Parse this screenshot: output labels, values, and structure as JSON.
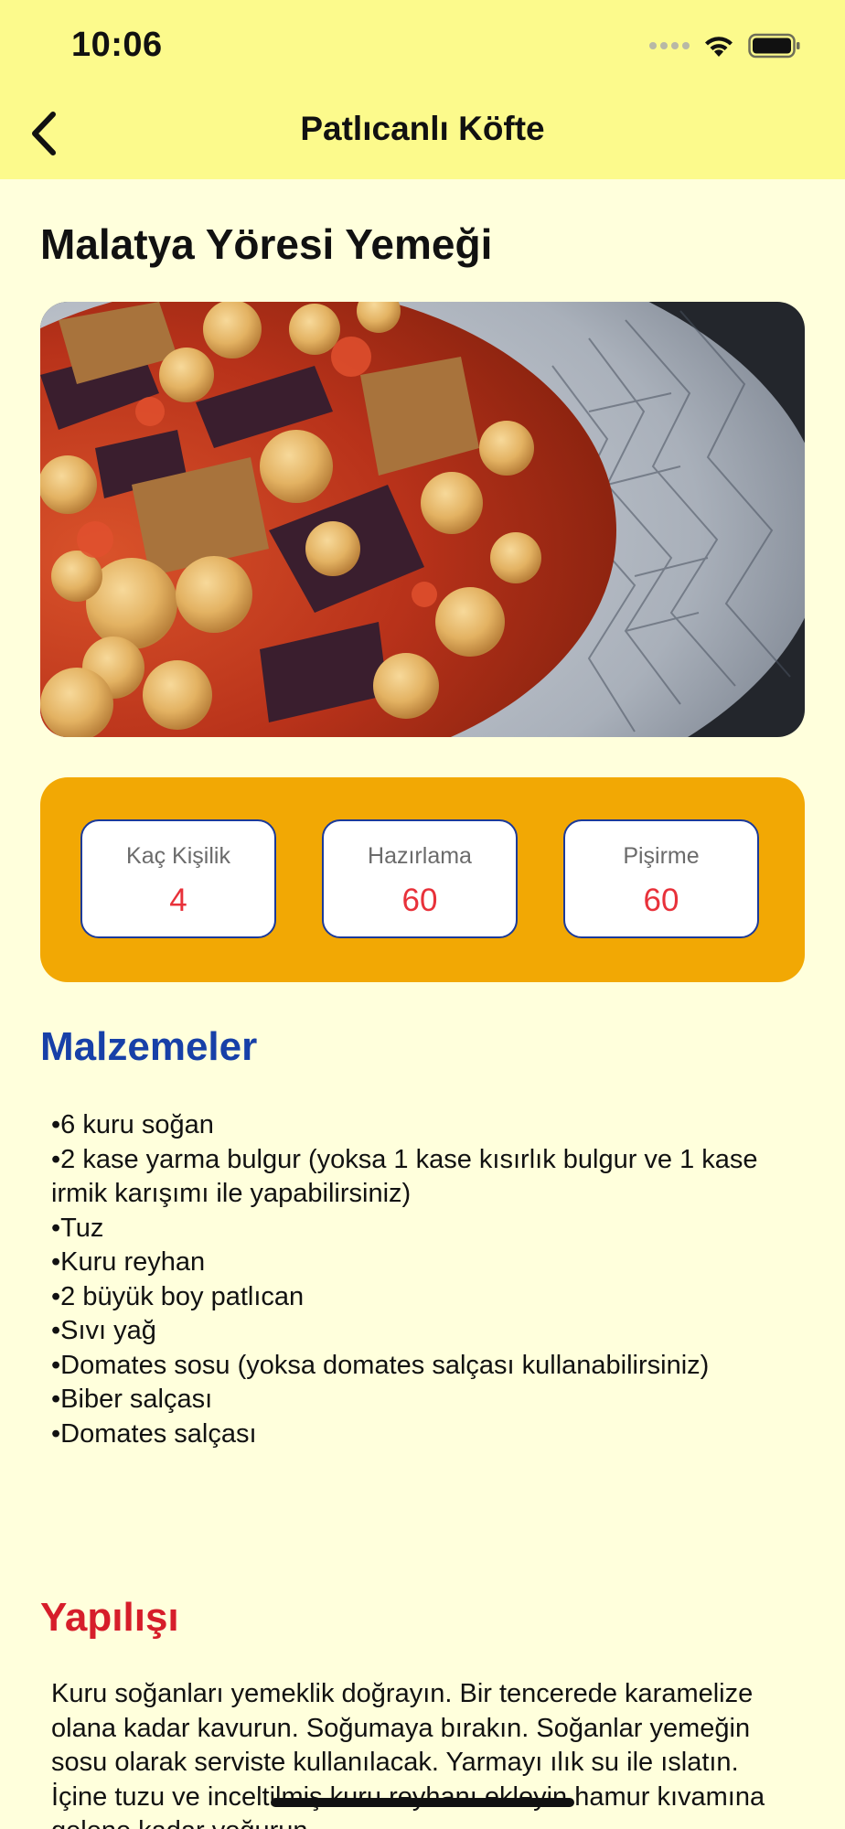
{
  "status_bar": {
    "time": "10:06",
    "icons": [
      "signal-dots-icon",
      "wifi-icon",
      "battery-icon"
    ]
  },
  "nav": {
    "title": "Patlıcanlı Köfte",
    "back_icon": "chevron-left-icon"
  },
  "recipe": {
    "region": "Malatya Yöresi Yemeği",
    "image_alt": "patlican-kofte-dish"
  },
  "info": {
    "servings_label": "Kaç Kişilik",
    "servings_value": "4",
    "prep_label": "Hazırlama",
    "prep_value": "60",
    "cook_label": "Pişirme",
    "cook_value": "60"
  },
  "ingredients": {
    "title": "Malzemeler",
    "items": [
      "6 kuru soğan",
      "2 kase yarma bulgur (yoksa 1 kase kısırlık bulgur ve 1 kase irmik karışımı ile yapabilirsiniz)",
      "Tuz",
      "Kuru reyhan",
      "2 büyük boy patlıcan",
      "Sıvı yağ",
      "Domates sosu (yoksa domates salçası kullanabilirsiniz)",
      "Biber salçası",
      "Domates salçası"
    ]
  },
  "method": {
    "title": "Yapılışı",
    "text": "Kuru soğanları yemeklik doğrayın. Bir tencerede karamelize olana kadar kavurun. Soğumaya bırakın. Soğanlar yemeğin sosu olarak serviste kullanılacak. Yarmayı ılık su ile ıslatın. İçine tuzu ve inceltilmiş kuru reyhanı ekleyin hamur kıvamına gelene kadar yoğurun."
  },
  "colors": {
    "top_bar": "#FCFA8C",
    "background": "#FFFFDC",
    "info_card": "#F2A804",
    "info_border": "#1B3A9A",
    "value_red": "#E8313A",
    "ingredients_title": "#1740A8",
    "method_title": "#D61E2A"
  }
}
